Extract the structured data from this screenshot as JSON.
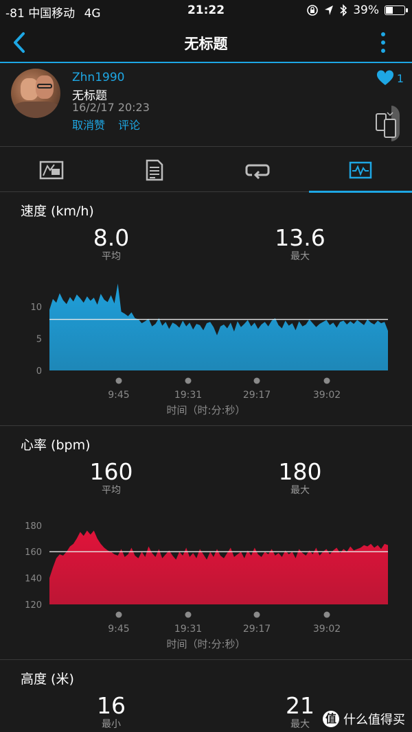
{
  "status_bar": {
    "signal": "-81",
    "carrier": "中国移动",
    "network": "4G",
    "time": "21:22",
    "battery": "39%",
    "battery_level": 0.39
  },
  "nav": {
    "title": "无标题",
    "back_icon": "chevron-left-icon",
    "more_icon": "vertical-dots-icon"
  },
  "activity": {
    "username": "Zhn1990",
    "name": "无标题",
    "datetime": "16/2/17 20:23",
    "unlike_label": "取消赞",
    "comment_label": "评论",
    "like_count": "1"
  },
  "tabs": [
    {
      "icon": "map-overview-icon"
    },
    {
      "icon": "details-list-icon"
    },
    {
      "icon": "laps-loop-icon"
    },
    {
      "icon": "chart-pulse-icon",
      "active": true
    }
  ],
  "colors": {
    "accent": "#1ea7e4",
    "speed_fill": "#1f9fda",
    "hr_fill": "#e0143a"
  },
  "sections": {
    "speed": {
      "title": "速度 (km/h)",
      "avg_value": "8.0",
      "avg_label": "平均",
      "max_value": "13.6",
      "max_label": "最大",
      "xlabel": "时间（时:分:秒）"
    },
    "heart_rate": {
      "title": "心率 (bpm)",
      "avg_value": "160",
      "avg_label": "平均",
      "max_value": "180",
      "max_label": "最大",
      "xlabel": "时间（时:分:秒）"
    },
    "elevation": {
      "title": "高度 (米)",
      "min_value": "16",
      "min_label": "最小",
      "max_value": "21",
      "max_label": "最大"
    }
  },
  "watermark": {
    "logo": "值",
    "text": "什么值得买"
  },
  "chart_data": [
    {
      "type": "area",
      "name": "speed",
      "ylim": [
        0,
        13
      ],
      "yticks": [
        0,
        5,
        10
      ],
      "xticks": [
        "9:45",
        "19:31",
        "29:17",
        "39:02"
      ],
      "average_line": 8.0,
      "color": "#1f9fda",
      "values": [
        9.5,
        11.2,
        10.6,
        12.1,
        11.0,
        10.4,
        11.5,
        10.8,
        11.9,
        11.3,
        10.6,
        11.6,
        10.9,
        11.4,
        10.3,
        12.0,
        11.1,
        10.7,
        11.8,
        10.5,
        13.6,
        9.2,
        8.9,
        8.5,
        9.1,
        8.2,
        8.0,
        7.4,
        7.7,
        8.1,
        6.9,
        7.3,
        8.2,
        7.0,
        7.6,
        6.5,
        7.5,
        7.2,
        6.7,
        7.8,
        6.9,
        7.5,
        6.4,
        7.3,
        7.1,
        6.3,
        7.4,
        7.6,
        6.8,
        5.5,
        6.9,
        7.2,
        6.6,
        7.5,
        6.1,
        7.7,
        6.8,
        7.3,
        7.9,
        6.9,
        7.5,
        6.5,
        7.2,
        7.6,
        6.9,
        7.8,
        8.2,
        7.1,
        6.6,
        7.8,
        7.0,
        7.4,
        6.3,
        7.7,
        6.9,
        7.2,
        8.0,
        7.4,
        6.8,
        7.3,
        7.6,
        7.9,
        7.1,
        7.5,
        6.7,
        7.6,
        7.8,
        7.2,
        7.7,
        7.3,
        7.9,
        7.5,
        7.1,
        8.0,
        7.5,
        7.2,
        7.8,
        7.4,
        7.6,
        6.2
      ]
    },
    {
      "type": "area",
      "name": "heart_rate",
      "ylim": [
        120,
        183
      ],
      "yticks": [
        120,
        140,
        160,
        180
      ],
      "xticks": [
        "9:45",
        "19:31",
        "29:17",
        "39:02"
      ],
      "average_line": 160,
      "color": "#e0143a",
      "values": [
        140,
        148,
        155,
        158,
        157,
        160,
        164,
        166,
        170,
        175,
        172,
        176,
        173,
        176,
        170,
        166,
        163,
        161,
        160,
        158,
        157,
        162,
        156,
        158,
        163,
        157,
        155,
        160,
        156,
        164,
        159,
        156,
        162,
        155,
        158,
        161,
        157,
        154,
        160,
        157,
        163,
        156,
        159,
        155,
        162,
        158,
        154,
        160,
        156,
        162,
        157,
        155,
        159,
        163,
        156,
        158,
        160,
        155,
        161,
        157,
        163,
        158,
        156,
        160,
        158,
        162,
        157,
        159,
        156,
        161,
        158,
        160,
        155,
        162,
        159,
        157,
        161,
        158,
        163,
        157,
        160,
        162,
        158,
        161,
        163,
        159,
        162,
        160,
        164,
        161,
        162,
        163,
        165,
        164,
        166,
        163,
        165,
        162,
        166,
        165
      ]
    }
  ]
}
